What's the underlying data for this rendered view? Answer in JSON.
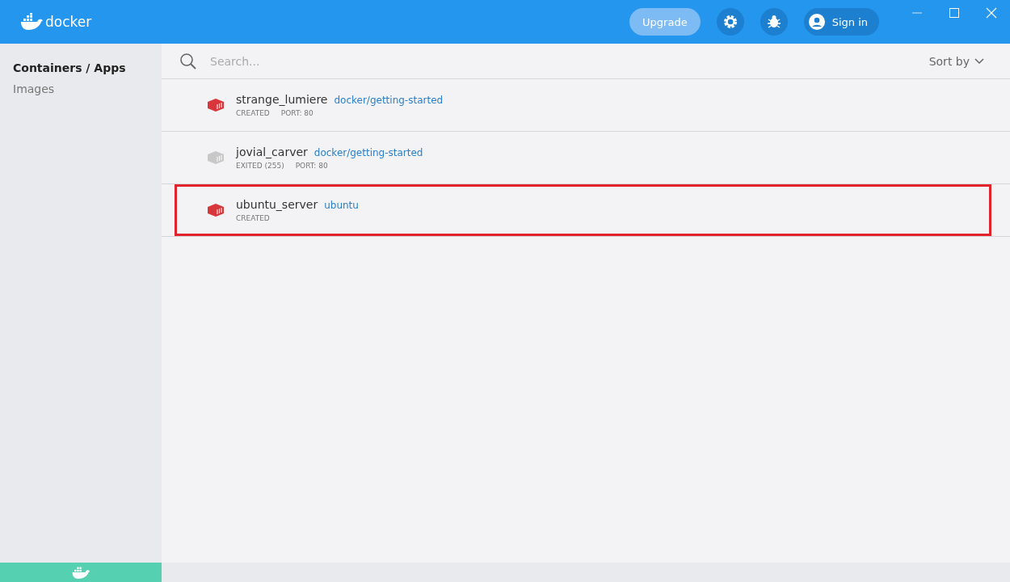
{
  "header": {
    "logo_text": "docker",
    "upgrade": "Upgrade",
    "sign_in": "Sign in"
  },
  "sidebar": {
    "items": [
      {
        "label": "Containers / Apps",
        "selected": true
      },
      {
        "label": "Images",
        "selected": false
      }
    ]
  },
  "search": {
    "placeholder": "Search..."
  },
  "sort": {
    "label": "Sort by"
  },
  "containers": [
    {
      "name": "strange_lumiere",
      "image": "docker/getting-started",
      "status": "CREATED",
      "port": "PORT: 80",
      "color": "#d9363b",
      "highlighted": false
    },
    {
      "name": "jovial_carver",
      "image": "docker/getting-started",
      "status": "EXITED (255)",
      "port": "PORT: 80",
      "color": "#c8c8c8",
      "highlighted": false
    },
    {
      "name": "ubuntu_server",
      "image": "ubuntu",
      "status": "CREATED",
      "color": "#d9363b",
      "highlighted": true
    }
  ]
}
